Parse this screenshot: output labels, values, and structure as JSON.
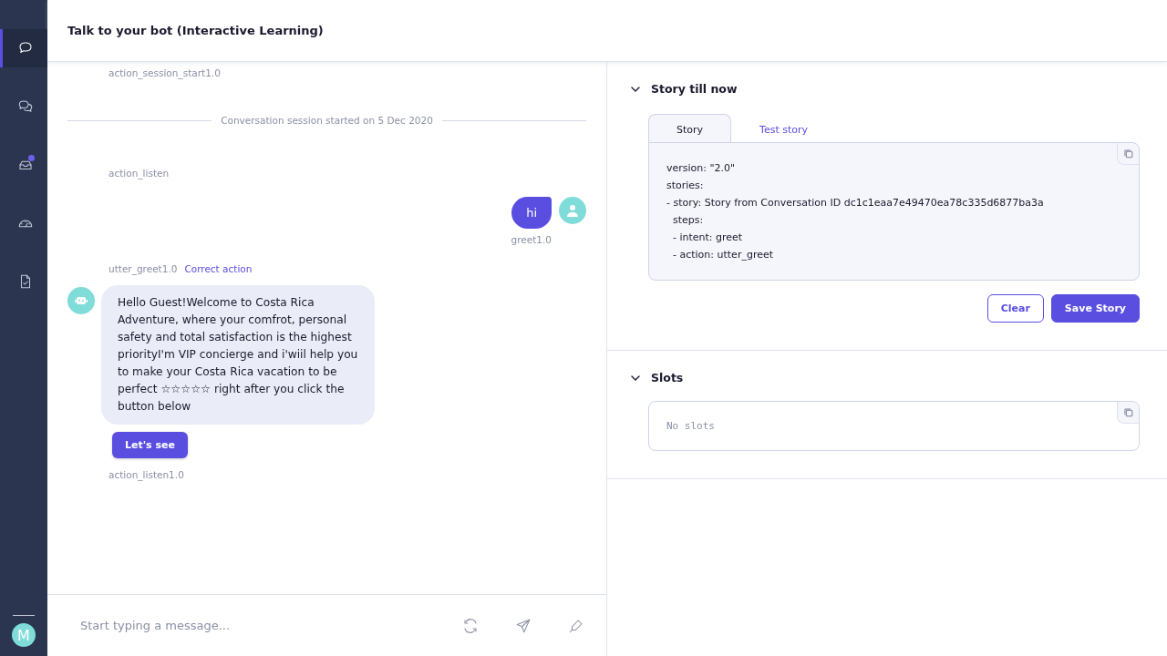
{
  "sidebar": {
    "items": [
      {
        "selected": true,
        "badge": false
      },
      {
        "selected": false,
        "badge": false
      },
      {
        "selected": false,
        "badge": true
      },
      {
        "selected": false,
        "badge": false
      },
      {
        "selected": false,
        "badge": false
      }
    ],
    "avatar": {
      "initial": "M"
    }
  },
  "header": {
    "title": "Talk to your bot (Interactive Learning)"
  },
  "conversation": {
    "events": [
      {
        "kind": "action",
        "label": "action_session_start1.0"
      },
      {
        "kind": "divider",
        "text": "Conversation session started on 5 Dec 2020"
      },
      {
        "kind": "action",
        "label": "action_listen"
      },
      {
        "kind": "user",
        "text": "hi",
        "intent": "greet1.0"
      },
      {
        "kind": "action",
        "label": "utter_greet1.0",
        "link": "Correct action"
      },
      {
        "kind": "bot",
        "text": "Hello Guest!Welcome to Costa Rica Adventure, where your comfrot, personal safety and total satisfaction is the highest priorityI'm VIP concierge and i'wiil help you to make your Costa Rica vacation to be perfect ☆☆☆☆☆ right after you click the button below",
        "buttons": [
          "Let's see"
        ]
      },
      {
        "kind": "action",
        "label": "action_listen1.0"
      }
    ]
  },
  "composer": {
    "placeholder": "Start typing a message..."
  },
  "story": {
    "title": "Story till now",
    "expanded": true,
    "tabs": [
      {
        "label": "Story",
        "selected": true
      },
      {
        "label": "Test story",
        "selected": false
      }
    ],
    "lines": [
      "version: \"2.0\"",
      "stories:",
      "- story: Story from Conversation ID dc1c1eaa7e49470ea78c335d6877ba3a",
      "  steps:",
      "  - intent: greet",
      "  - action: utter_greet"
    ],
    "buttons": [
      {
        "label": "Clear",
        "kind": "secondary"
      },
      {
        "label": "Save Story",
        "kind": "primary"
      }
    ]
  },
  "slots": {
    "title": "Slots",
    "expanded": true,
    "empty_text": "No slots"
  }
}
